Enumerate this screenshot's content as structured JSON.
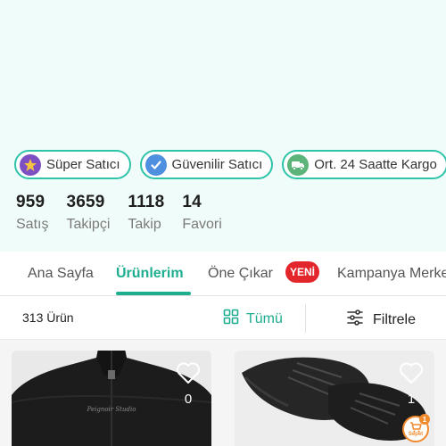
{
  "badges": [
    {
      "label": "Süper Satıcı",
      "icon": "star-badge-icon"
    },
    {
      "label": "Güvenilir Satıcı",
      "icon": "verified-check-icon"
    },
    {
      "label": "Ort. 24 Saatte Kargo",
      "icon": "truck-icon"
    }
  ],
  "stats": [
    {
      "value": "959",
      "label": "Satış"
    },
    {
      "value": "3659",
      "label": "Takipçi"
    },
    {
      "value": "1118",
      "label": "Takip"
    },
    {
      "value": "14",
      "label": "Favori"
    }
  ],
  "tabs": [
    {
      "label": "Ana Sayfa",
      "active": false
    },
    {
      "label": "Ürünlerim",
      "active": true
    },
    {
      "label": "Öne Çıkar",
      "active": false
    },
    {
      "label": "Kampanya Merkezi",
      "active": false
    }
  ],
  "new_badge": "YENİ",
  "filterbar": {
    "count": "313 Ürün",
    "all_label": "Tümü",
    "filter_label": "Filtrele"
  },
  "products": [
    {
      "favorites": "0",
      "image": "black zip-neck sweater",
      "print": "Peignoir Studio"
    },
    {
      "favorites": "1",
      "image": "black sneakers"
    }
  ],
  "cart": {
    "label": "Sepet",
    "count": "1"
  },
  "colors": {
    "accent": "#1eae8f",
    "badge_border": "#2ec4a9",
    "hero_bg": "#f0fcf9",
    "new_badge": "#e2262b",
    "cart": "#f08a2c"
  }
}
